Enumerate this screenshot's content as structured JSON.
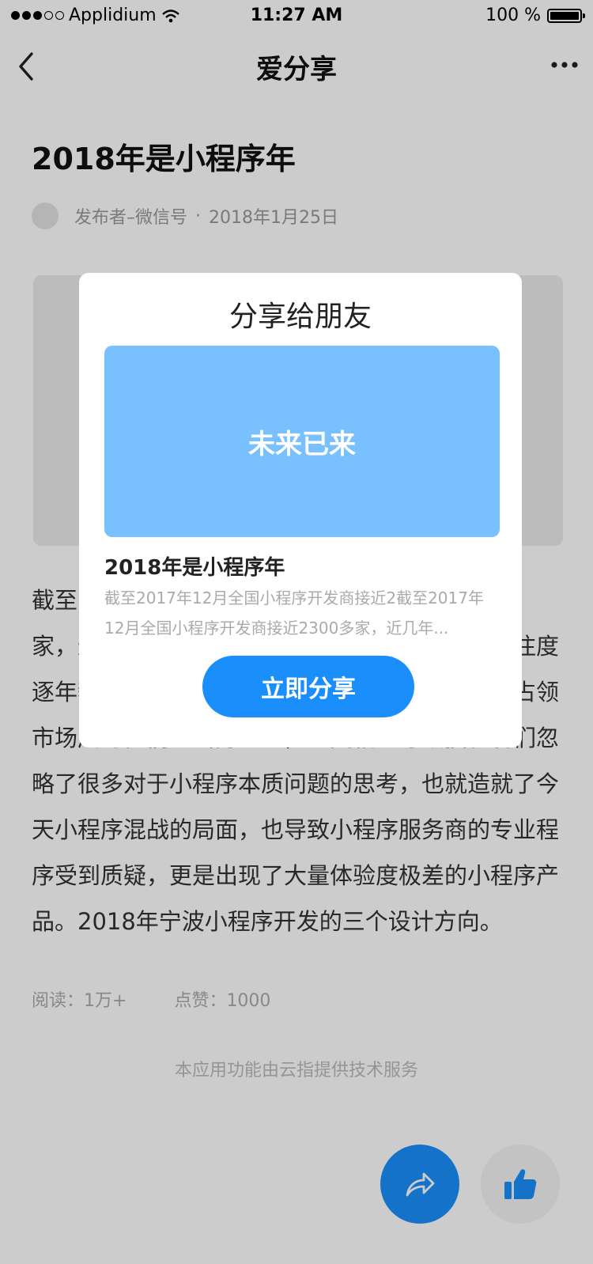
{
  "status_bar": {
    "carrier": "Applidium",
    "time": "11:27 AM",
    "battery": "100 %"
  },
  "nav": {
    "title": "爱分享",
    "back_icon": "chevron-left-icon",
    "more_icon": "more-dots-icon"
  },
  "article": {
    "title": "2018年是小程序年",
    "author": "发布者–微信号",
    "separator": "·",
    "date": "2018年1月25日",
    "body": "截至2017年12月全国小程序开发商接近2300多家，近几年小程序的迅速崛起，使其备受到的关注度逐年攀升，对于小程序开发商们来说，如何快速占领市场成为他们的当务之急，也变相的导致投机者们忽略了很多对于小程序本质问题的思考，也就造就了今天小程序混战的局面，也导致小程序服务商的专业程序受到质疑，更是出现了大量体验度极差的小程序产品。2018年宁波小程序开发的三个设计方向。",
    "reads": "阅读：1万+",
    "likes": "点赞：1000"
  },
  "footer": {
    "note": "本应用功能由云指提供技术服务"
  },
  "fabs": {
    "share_icon": "share-arrow-icon",
    "like_icon": "thumbs-up-icon"
  },
  "modal": {
    "title": "分享给朋友",
    "preview_text": "未来已来",
    "preview_title": "2018年是小程序年",
    "preview_desc": "截至2017年12月全国小程序开发商接近2截至2017年12月全国小程序开发商接近2300多家，近几年...",
    "button_label": "立即分享"
  },
  "colors": {
    "accent": "#1a8ffb",
    "preview_bg": "#79c1fe",
    "overlay": "rgba(0,0,0,0.2)"
  }
}
